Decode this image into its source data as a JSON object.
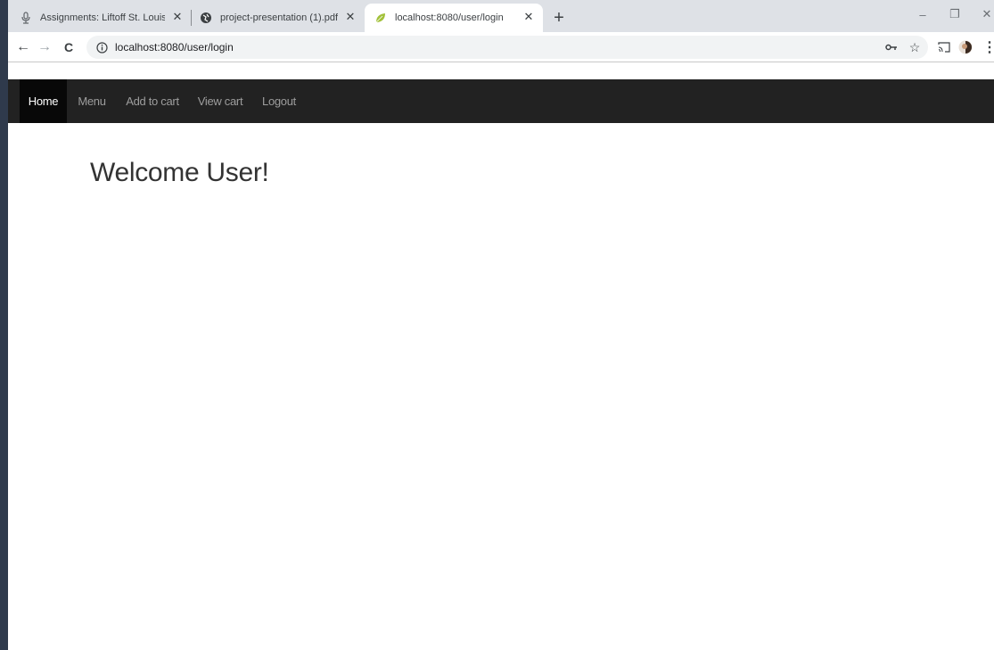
{
  "browser": {
    "tabs": [
      {
        "title": "Assignments: Liftoff St. Louis (Jul",
        "active": false,
        "icon": "mic-icon"
      },
      {
        "title": "project-presentation (1).pdf",
        "active": false,
        "icon": "globe-icon"
      },
      {
        "title": "localhost:8080/user/login",
        "active": true,
        "icon": "leaf-icon"
      }
    ],
    "tab_close": "✕",
    "new_tab": "+",
    "window_controls": {
      "minimize": "–",
      "restore": "❐",
      "close": "✕"
    },
    "nav": {
      "back": "←",
      "forward": "→",
      "reload": "C"
    },
    "url": "localhost:8080/user/login",
    "icons": {
      "key": "key-icon",
      "star": "☆",
      "cast": "cast-icon",
      "avatar": "avatar-icon",
      "menu": "⋮"
    }
  },
  "page": {
    "navbar": {
      "items": [
        {
          "label": "Home",
          "active": true
        },
        {
          "label": "Menu",
          "active": false
        },
        {
          "label": "Add to cart",
          "active": false
        },
        {
          "label": "View cart",
          "active": false
        },
        {
          "label": "Logout",
          "active": false
        }
      ]
    },
    "heading": "Welcome User!"
  },
  "colors": {
    "navbar_bg": "#222222",
    "navbar_active_bg": "#080808",
    "navbar_link": "#9d9d9d",
    "desktop_bg": "#2f3a4c",
    "leaf": "#a2c13a"
  }
}
